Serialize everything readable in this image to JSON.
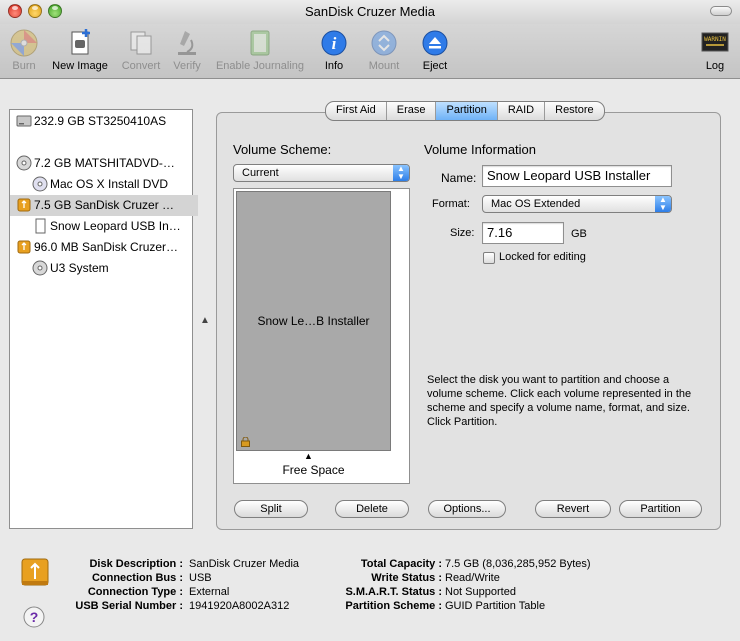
{
  "window": {
    "title": "SanDisk Cruzer Media"
  },
  "toolbar": {
    "burn": "Burn",
    "new_image": "New Image",
    "convert": "Convert",
    "verify": "Verify",
    "enable_journaling": "Enable Journaling",
    "info": "Info",
    "mount": "Mount",
    "eject": "Eject",
    "log": "Log",
    "log_icon_text": "WARNIN"
  },
  "sidebar": {
    "items": [
      {
        "label": "232.9 GB ST3250410AS",
        "icon": "hard-disk-icon"
      },
      {
        "label": "7.2 GB MATSHITADVD-…",
        "icon": "optical-drive-icon"
      },
      {
        "label": "Mac OS X Install DVD",
        "icon": "dvd-disc-icon"
      },
      {
        "label": "7.5 GB SanDisk Cruzer …",
        "icon": "usb-drive-icon"
      },
      {
        "label": "Snow Leopard USB In…",
        "icon": "volume-icon"
      },
      {
        "label": "96.0 MB SanDisk Cruzer…",
        "icon": "usb-drive-icon"
      },
      {
        "label": "U3 System",
        "icon": "cd-disc-icon"
      }
    ]
  },
  "tabs": [
    "First Aid",
    "Erase",
    "Partition",
    "RAID",
    "Restore"
  ],
  "partition": {
    "scheme_label": "Volume Scheme:",
    "scheme_value": "Current",
    "volume_info_label": "Volume Information",
    "name_label": "Name:",
    "name_value": "Snow Leopard USB Installer",
    "format_label": "Format:",
    "format_value": "Mac OS Extended",
    "size_label": "Size:",
    "size_value": "7.16",
    "size_unit": "GB",
    "locked_label": "Locked for editing",
    "volume_block_label": "Snow Le…B Installer",
    "free_space_label": "Free Space",
    "help_text": "Select the disk you want to partition and choose a volume scheme. Click each volume represented in the scheme and specify a volume name, format, and size. Click Partition."
  },
  "buttons": {
    "split": "Split",
    "delete": "Delete",
    "options": "Options...",
    "revert": "Revert",
    "partition": "Partition"
  },
  "info": {
    "disk_description_label": "Disk Description :",
    "disk_description": "SanDisk Cruzer Media",
    "connection_bus_label": "Connection Bus :",
    "connection_bus": "USB",
    "connection_type_label": "Connection Type :",
    "connection_type": "External",
    "usb_serial_label": "USB Serial Number :",
    "usb_serial": "1941920A8002A312",
    "total_capacity_label": "Total Capacity :",
    "total_capacity": "7.5 GB (8,036,285,952 Bytes)",
    "write_status_label": "Write Status :",
    "write_status": "Read/Write",
    "smart_status_label": "S.M.A.R.T. Status :",
    "smart_status": "Not Supported",
    "partition_scheme_label": "Partition Scheme :",
    "partition_scheme": "GUID Partition Table"
  },
  "colors": {
    "selection_gray": "#d4d4d4",
    "active_tab_blue": "#6fb2f7",
    "volume_gray": "#a9a9a9"
  }
}
